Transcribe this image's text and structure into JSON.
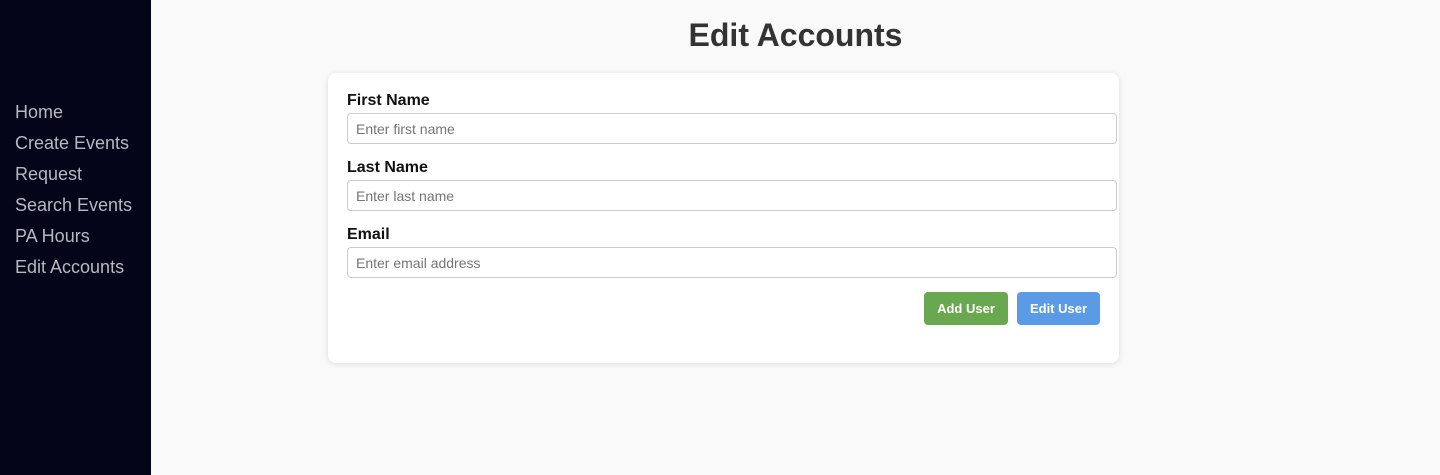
{
  "sidebar": {
    "items": [
      {
        "label": "Home"
      },
      {
        "label": "Create Events"
      },
      {
        "label": "Request"
      },
      {
        "label": "Search Events"
      },
      {
        "label": "PA Hours"
      },
      {
        "label": "Edit Accounts"
      }
    ]
  },
  "main": {
    "title": "Edit Accounts"
  },
  "form": {
    "first_name": {
      "label": "First Name",
      "value": "",
      "placeholder": "Enter first name"
    },
    "last_name": {
      "label": "Last Name",
      "value": "",
      "placeholder": "Enter last name"
    },
    "email": {
      "label": "Email",
      "value": "",
      "placeholder": "Enter email address"
    },
    "add_user_label": "Add User",
    "edit_user_label": "Edit User"
  },
  "colors": {
    "sidebar_bg": "#05051a",
    "add_button": "#6aa84f",
    "edit_button": "#5b9be6"
  }
}
